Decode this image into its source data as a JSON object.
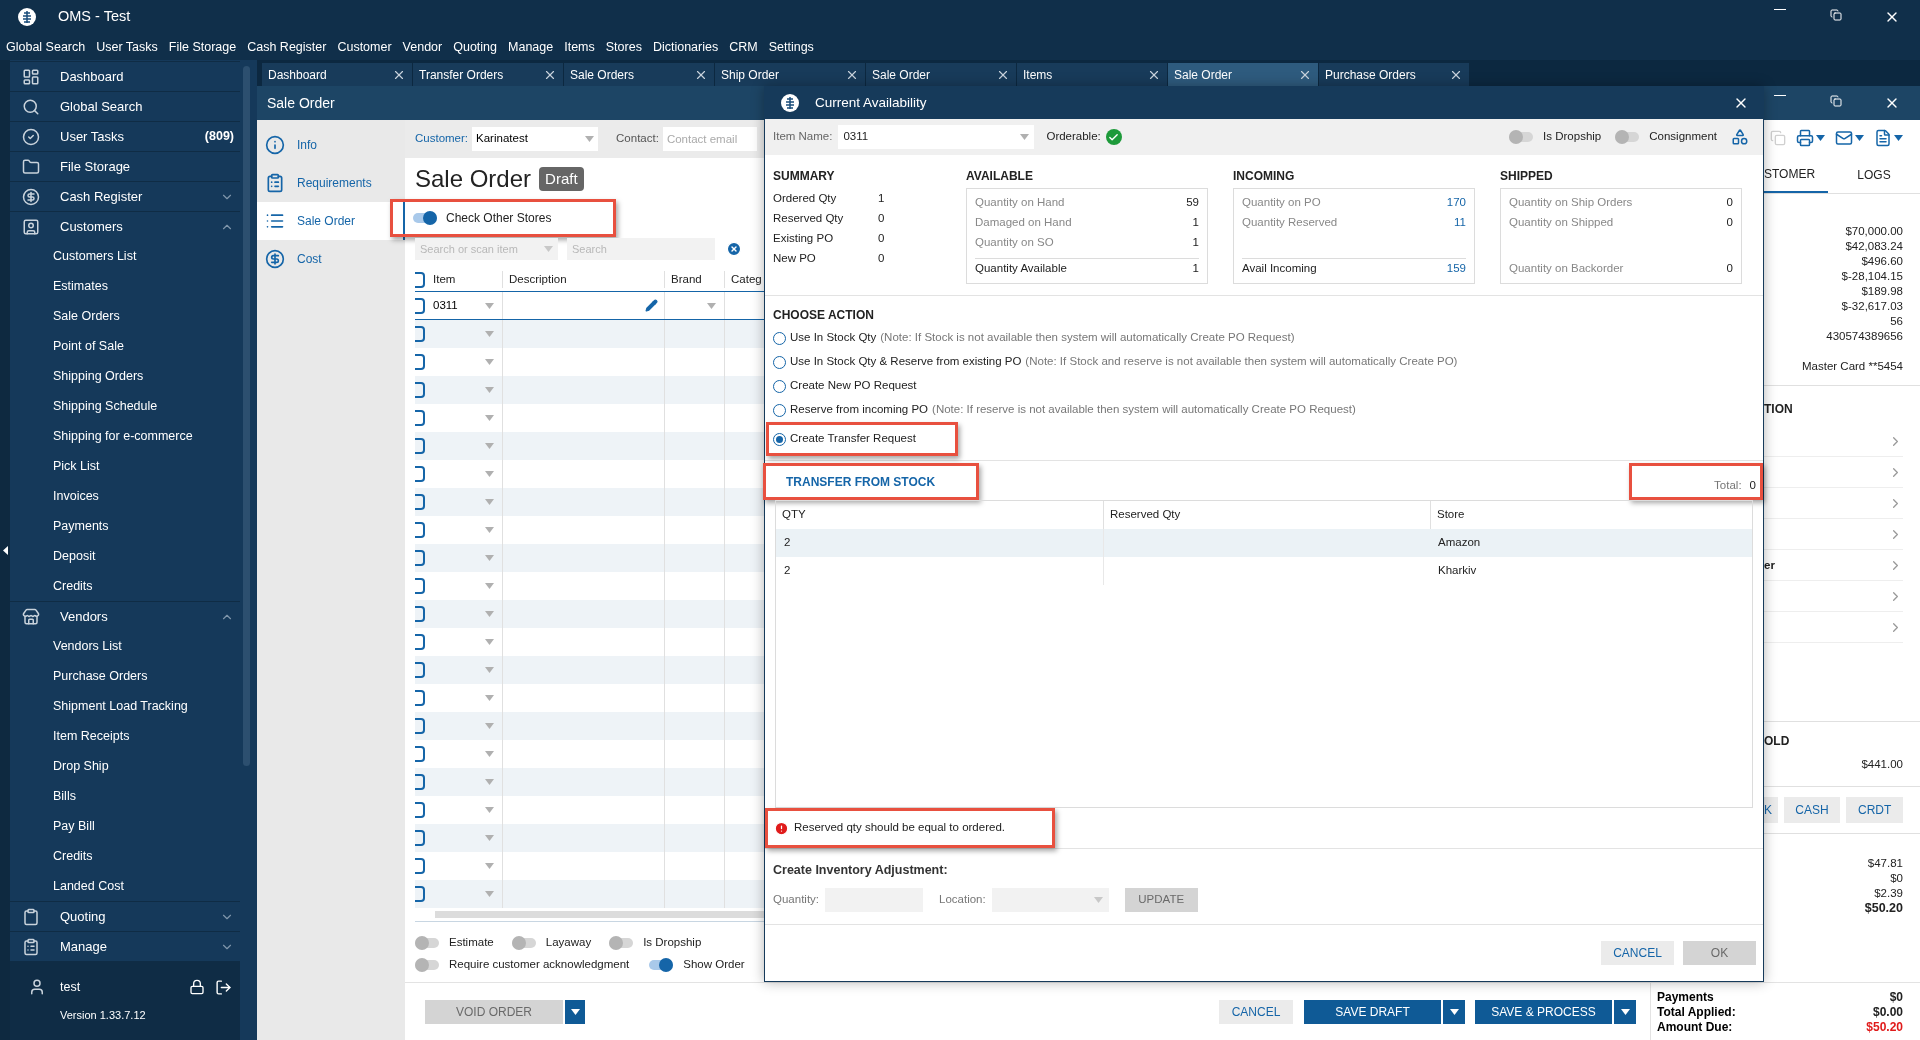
{
  "app": {
    "title": "OMS - Test"
  },
  "menu": [
    "Global Search",
    "User Tasks",
    "File Storage",
    "Cash Register",
    "Customer",
    "Vendor",
    "Quoting",
    "Manage",
    "Items",
    "Stores",
    "Dictionaries",
    "CRM",
    "Settings"
  ],
  "sidebar": {
    "items": [
      {
        "label": "Dashboard"
      },
      {
        "label": "Global Search"
      },
      {
        "label": "User Tasks",
        "count": "(809)"
      },
      {
        "label": "File Storage"
      },
      {
        "label": "Cash Register",
        "expanded": false
      },
      {
        "label": "Customers",
        "expanded": true,
        "children": [
          {
            "label": "Customers List"
          },
          {
            "label": "Estimates"
          },
          {
            "label": "Sale Orders"
          },
          {
            "label": "Point of Sale"
          },
          {
            "label": "Shipping Orders"
          },
          {
            "label": "Shipping Schedule"
          },
          {
            "label": "Shipping for e-commerce"
          },
          {
            "label": "Pick List"
          },
          {
            "label": "Invoices"
          },
          {
            "label": "Payments"
          },
          {
            "label": "Deposit"
          },
          {
            "label": "Credits"
          }
        ]
      },
      {
        "label": "Vendors",
        "expanded": true,
        "children": [
          {
            "label": "Vendors List"
          },
          {
            "label": "Purchase Orders"
          },
          {
            "label": "Shipment Load Tracking"
          },
          {
            "label": "Item Receipts"
          },
          {
            "label": "Drop Ship"
          },
          {
            "label": "Bills"
          },
          {
            "label": "Pay Bill"
          },
          {
            "label": "Credits"
          },
          {
            "label": "Landed Cost"
          }
        ]
      },
      {
        "label": "Quoting",
        "expanded": false
      },
      {
        "label": "Manage",
        "expanded": false
      }
    ],
    "user": "test",
    "version": "Version 1.33.7.12"
  },
  "tabs": [
    {
      "label": "Dashboard",
      "selected": false
    },
    {
      "label": "Transfer Orders",
      "selected": false
    },
    {
      "label": "Sale Orders",
      "selected": false
    },
    {
      "label": "Ship Order",
      "selected": false
    },
    {
      "label": "Sale Order",
      "selected": false
    },
    {
      "label": "Items",
      "selected": false
    },
    {
      "label": "Sale Order",
      "selected": true
    },
    {
      "label": "Purchase Orders",
      "selected": false
    }
  ],
  "window": {
    "title": "Sale Order"
  },
  "nav": [
    {
      "label": "Info",
      "selected": false
    },
    {
      "label": "Requirements",
      "selected": false
    },
    {
      "label": "Sale Order",
      "selected": true
    },
    {
      "label": "Cost",
      "selected": false
    }
  ],
  "order": {
    "customer_label": "Customer:",
    "customer": "Karinatest",
    "contact_label": "Contact:",
    "contact_placeholder": "Contact email",
    "heading": "Sale Order",
    "status": "Draft",
    "check_other_stores": {
      "label": "Check Other Stores",
      "on": true,
      "highlighted": true
    },
    "item_search_placeholder": "Search or scan item",
    "search_placeholder": "Search",
    "header_checked": false,
    "columns": [
      "Item",
      "Description",
      "Brand",
      "Categ"
    ],
    "rows": [
      {
        "checked": false,
        "item": "0311"
      },
      {
        "checked": false
      },
      {
        "checked": false
      },
      {
        "checked": false
      },
      {
        "checked": false
      },
      {
        "checked": false
      },
      {
        "checked": false
      },
      {
        "checked": false
      },
      {
        "checked": false
      },
      {
        "checked": false
      },
      {
        "checked": false
      },
      {
        "checked": false
      },
      {
        "checked": false
      },
      {
        "checked": false
      },
      {
        "checked": false
      },
      {
        "checked": false
      },
      {
        "checked": false
      },
      {
        "checked": false
      },
      {
        "checked": false
      },
      {
        "checked": false
      },
      {
        "checked": false
      },
      {
        "checked": false
      }
    ],
    "options": [
      {
        "label": "Estimate",
        "on": false
      },
      {
        "label": "Layaway",
        "on": false
      },
      {
        "label": "Is Dropship",
        "on": false
      },
      {
        "label": "Require customer acknowledgment",
        "on": false
      },
      {
        "label": "Show Order",
        "on": true
      }
    ]
  },
  "footer": {
    "void": {
      "label": "VOID ORDER",
      "disabled": true
    },
    "cancel": "CANCEL",
    "save_draft": "SAVE DRAFT",
    "save_process": "SAVE & PROCESS",
    "payments": [
      {
        "label": "Payments",
        "value": "$0",
        "kind": "paid"
      },
      {
        "label": "Total Applied:",
        "value": "$0.00",
        "kind": "paid"
      },
      {
        "label": "Amount Due:",
        "value": "$50.20",
        "kind": "due"
      }
    ]
  },
  "right_panel": {
    "tabs": [
      {
        "label": "STOMER",
        "selected": true
      },
      {
        "label": "LOGS",
        "selected": false
      }
    ],
    "amounts": [
      "$70,000.00",
      "$42,083.24",
      "$496.60",
      "$-28,104.15",
      "$189.98",
      "$-32,617.03",
      "56",
      "430574389656"
    ],
    "card": "Master Card **5454",
    "section": "TION",
    "links": [
      {
        "kind": "link"
      },
      {
        "kind": "link"
      },
      {
        "kind": "link"
      },
      {
        "kind": "link"
      },
      {
        "kind": "link",
        "label": "er"
      },
      {
        "kind": "link"
      },
      {
        "kind": "link"
      }
    ],
    "hold_title": "OLD",
    "hold_value": "$441.00",
    "pay_buttons": [
      "K",
      "CASH",
      "CRDT"
    ],
    "totals": [
      {
        "value": "$47.81",
        "kind": "line"
      },
      {
        "value": "$0",
        "kind": "line"
      },
      {
        "value": "$2.39",
        "kind": "line"
      },
      {
        "value": "$50.20",
        "kind": "total"
      }
    ]
  },
  "dialog": {
    "title": "Current Availability",
    "item_name_label": "Item Name:",
    "item_name": "0311",
    "orderable_label": "Orderable:",
    "orderable": true,
    "toggles": [
      {
        "label": "Is Dropship",
        "on": false
      },
      {
        "label": "Consignment",
        "on": false
      }
    ],
    "summary": {
      "title": "SUMMARY",
      "rows": [
        {
          "label": "Ordered Qty",
          "value": "1"
        },
        {
          "label": "Reserved Qty",
          "value": "0"
        },
        {
          "label": "Existing PO",
          "value": "0"
        },
        {
          "label": "New PO",
          "value": "0"
        }
      ]
    },
    "panels": [
      {
        "title": "AVAILABLE",
        "links": false,
        "rows": [
          {
            "label": "Quantity on Hand",
            "value": "59"
          },
          {
            "label": "Damaged on Hand",
            "value": "1"
          },
          {
            "label": "Quantity on SO",
            "value": "1"
          }
        ],
        "footer": {
          "label": "Quantity Available",
          "value": "1",
          "kind": "total"
        }
      },
      {
        "title": "INCOMING",
        "links": true,
        "rows": [
          {
            "label": "Quantity on PO",
            "value": "170"
          },
          {
            "label": "Quantity Reserved",
            "value": "11"
          }
        ],
        "footer": {
          "label": "Avail Incoming",
          "value": "159",
          "kind": "total"
        }
      },
      {
        "title": "SHIPPED",
        "links": false,
        "rows": [
          {
            "label": "Quantity on Ship Orders",
            "value": "0"
          },
          {
            "label": "Quantity on Shipped",
            "value": "0"
          }
        ],
        "footer": {
          "label": "Quantity on Backorder",
          "value": "0",
          "kind": "plain"
        }
      }
    ],
    "choose_action": {
      "title": "CHOOSE ACTION",
      "options": [
        {
          "label": "Use In Stock Qty",
          "note": "(Note: If Stock is not available then system will automatically Create PO Request)",
          "selected": false,
          "highlighted": false
        },
        {
          "label": "Use In Stock Qty & Reserve from existing PO",
          "note": "(Note: If Stock and reserve is not available then system will automatically Create PO)",
          "selected": false,
          "highlighted": false
        },
        {
          "label": "Create New PO Request",
          "selected": false,
          "highlighted": false
        },
        {
          "label": "Reserve from incoming PO",
          "note": "(Note: If reserve is not available then system will automatically Create PO Request)",
          "selected": false,
          "highlighted": false
        },
        {
          "label": "Create Transfer Request",
          "selected": true,
          "highlighted": true
        }
      ]
    },
    "transfer": {
      "tab": "TRANSFER FROM STOCK",
      "tab_highlighted": true,
      "total_label": "Total:",
      "total": "0",
      "total_highlighted": true,
      "columns": [
        "QTY",
        "Reserved Qty",
        "Store"
      ],
      "rows": [
        {
          "qty": "2",
          "store": "Amazon",
          "selected": true
        },
        {
          "qty": "2",
          "store": "Kharkiv",
          "selected": false
        }
      ]
    },
    "error": {
      "message": "Reserved qty should be equal to ordered.",
      "highlighted": true
    },
    "adjustment": {
      "title": "Create Inventory Adjustment:",
      "quantity_label": "Quantity:",
      "location_label": "Location:",
      "update": {
        "label": "UPDATE",
        "disabled": true
      }
    },
    "buttons": [
      {
        "label": "CANCEL",
        "disabled": false
      },
      {
        "label": "OK",
        "disabled": true
      }
    ]
  }
}
